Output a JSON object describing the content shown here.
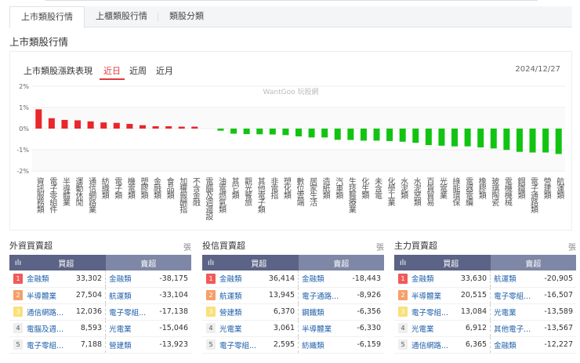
{
  "tabs": [
    "上市類股行情",
    "上櫃類股行情",
    "類股分類"
  ],
  "heading": "上市類股行情",
  "chart_title": "上市類股漲跌表現",
  "periods": [
    "近日",
    "近周",
    "近月"
  ],
  "date": "2024/12/27",
  "watermark": "WantGoo 玩股網",
  "colors": {
    "up": "#e8262b",
    "down": "#12c412"
  },
  "chart_data": {
    "type": "bar",
    "ylim": [
      -2,
      2
    ],
    "yticks": [
      "2%",
      "1%",
      "0%",
      "-1%",
      "-2%"
    ],
    "ytick_values": [
      2,
      1,
      0,
      -1,
      -2
    ],
    "categories": [
      "資訊服務類",
      "電子零組件",
      "半導體業",
      "運動休閒",
      "通信網路業",
      "紡織類",
      "電子類",
      "機電類",
      "塑膠類",
      "金融類",
      "食品類",
      "加權報酬指",
      "不含金融",
      "電腦及週邊設",
      "油電燃氣類",
      "其它類",
      "觀光餐旅",
      "其他電子類",
      "非電指",
      "塑化類",
      "數位雲端",
      "居家生活",
      "造紙類",
      "汽車類",
      "生技醫療業",
      "化生類",
      "未含電",
      "化學工業",
      "水泥類",
      "水泥窯類",
      "百貨貿易",
      "光電業",
      "綠能環保",
      "電器電纜",
      "橡膠類",
      "玻璃陶瓷",
      "電機機械",
      "鋼鐵類",
      "電子通路類",
      "營建類",
      "航運類"
    ],
    "values": [
      0.91,
      0.49,
      0.41,
      0.39,
      0.34,
      0.29,
      0.27,
      0.22,
      0.16,
      0.11,
      0.11,
      0.09,
      0.09,
      0,
      -0.1,
      -0.24,
      -0.26,
      -0.27,
      -0.28,
      -0.31,
      -0.37,
      -0.42,
      -0.42,
      -0.53,
      -0.54,
      -0.57,
      -0.57,
      -0.59,
      -0.62,
      -0.67,
      -0.78,
      -0.81,
      -0.84,
      -0.84,
      -0.89,
      -0.94,
      -1.01,
      -1.1,
      -1.13,
      -1.13,
      -1.2
    ]
  },
  "tables": [
    {
      "title": "外資買賣超",
      "unit": "張",
      "buy_header": "買超",
      "sell_header": "賣超",
      "rows": [
        [
          "1",
          "金融類",
          "33,302",
          "金融類",
          "-38,175"
        ],
        [
          "2",
          "半導體業",
          "27,504",
          "航運類",
          "-33,104"
        ],
        [
          "3",
          "通信網路...",
          "12,036",
          "電子零組...",
          "-17,138"
        ],
        [
          "4",
          "電腦及週...",
          "8,593",
          "光電業",
          "-15,046"
        ],
        [
          "5",
          "電子零組...",
          "7,188",
          "營建類",
          "-13,923"
        ]
      ]
    },
    {
      "title": "投信買賣超",
      "unit": "張",
      "buy_header": "買超",
      "sell_header": "賣超",
      "rows": [
        [
          "1",
          "金融類",
          "36,414",
          "金融類",
          "-18,443"
        ],
        [
          "2",
          "航運類",
          "13,945",
          "電子通路...",
          "-8,926"
        ],
        [
          "3",
          "營建類",
          "6,370",
          "鋼鐵類",
          "-6,356"
        ],
        [
          "4",
          "光電業",
          "3,061",
          "半導體業",
          "-6,330"
        ],
        [
          "5",
          "電子零組...",
          "2,595",
          "紡織類",
          "-6,159"
        ]
      ]
    },
    {
      "title": "主力買賣超",
      "unit": "張",
      "buy_header": "買超",
      "sell_header": "賣超",
      "rows": [
        [
          "1",
          "金融類",
          "33,630",
          "航運類",
          "-20,905"
        ],
        [
          "2",
          "半導體業",
          "20,515",
          "電子零組...",
          "-16,507"
        ],
        [
          "3",
          "電子零組...",
          "13,084",
          "光電業",
          "-13,589"
        ],
        [
          "4",
          "光電業",
          "6,912",
          "其他電子...",
          "-13,567"
        ],
        [
          "5",
          "通信網路...",
          "6,365",
          "金融類",
          "-12,227"
        ]
      ]
    }
  ]
}
